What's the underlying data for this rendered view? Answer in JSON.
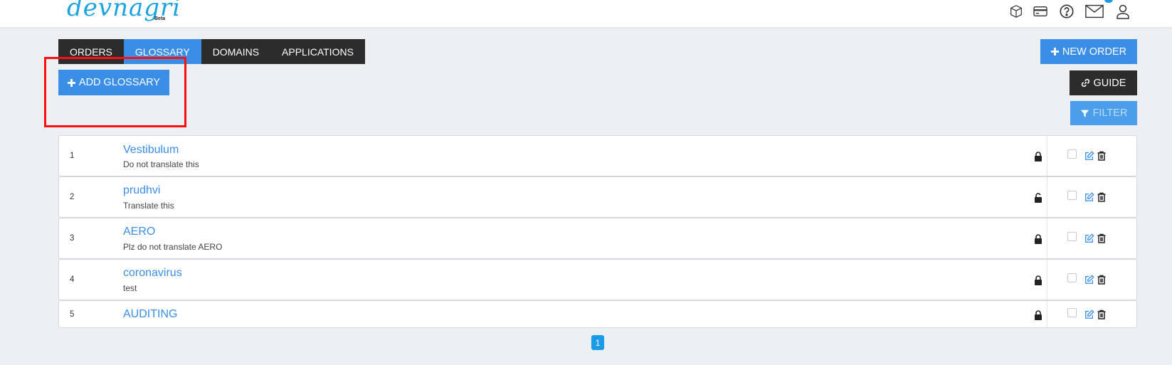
{
  "header": {
    "logo_text": "devnagri",
    "logo_badge": "Beta",
    "icons": [
      "package-icon",
      "credit-card-icon",
      "help-icon",
      "mail-icon",
      "user-icon"
    ]
  },
  "tabs": [
    {
      "label": "ORDERS",
      "active": false
    },
    {
      "label": "GLOSSARY",
      "active": true
    },
    {
      "label": "DOMAINS",
      "active": false
    },
    {
      "label": "APPLICATIONS",
      "active": false
    }
  ],
  "actions": {
    "new_order": "NEW ORDER",
    "add_glossary": "ADD GLOSSARY",
    "guide": "GUIDE",
    "filter": "FILTER"
  },
  "glossary": [
    {
      "num": "1",
      "title": "Vestibulum",
      "desc": "Do not translate this",
      "locked": true
    },
    {
      "num": "2",
      "title": "prudhvi",
      "desc": "Translate this",
      "locked": false
    },
    {
      "num": "3",
      "title": "AERO",
      "desc": "Plz do not translate AERO",
      "locked": true
    },
    {
      "num": "4",
      "title": "coronavirus",
      "desc": "test",
      "locked": true
    },
    {
      "num": "5",
      "title": "AUDITING",
      "desc": "",
      "locked": true
    }
  ],
  "pagination": {
    "current": "1"
  },
  "colors": {
    "accent": "#3a8ee6",
    "dark": "#2c2c2c",
    "highlight": "#ff1010",
    "background": "#edf0f3"
  }
}
